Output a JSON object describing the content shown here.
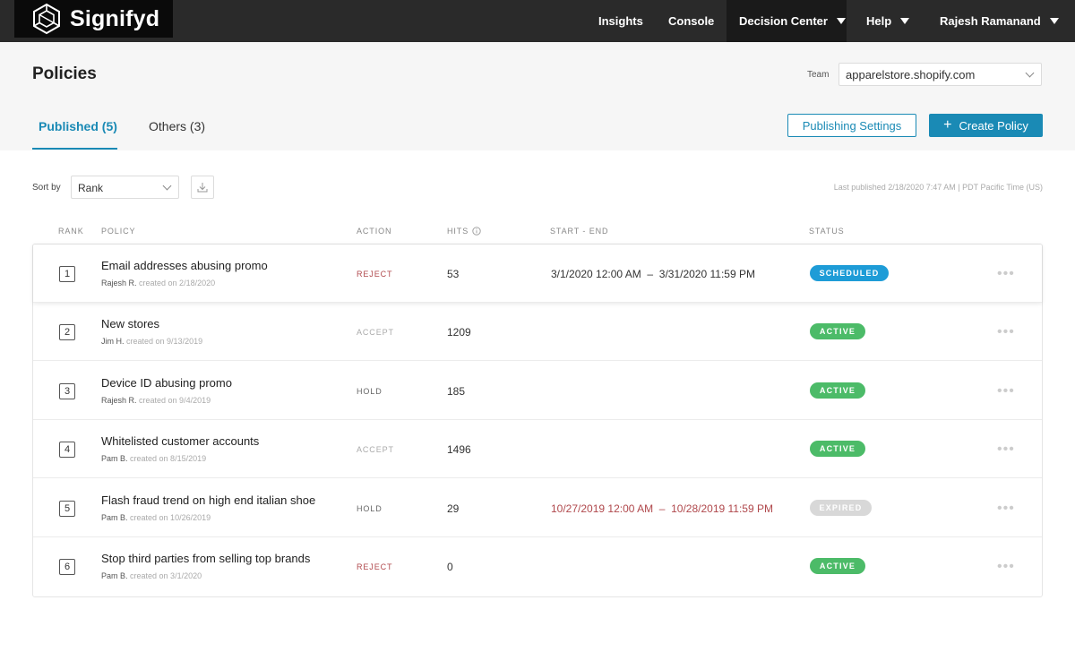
{
  "app": {
    "logo_text": "Signifyd"
  },
  "nav": {
    "insights": "Insights",
    "console": "Console",
    "decision_center": "Decision Center",
    "help": "Help",
    "user": "Rajesh Ramanand"
  },
  "page": {
    "title": "Policies",
    "team_label": "Team",
    "team_value": "apparelstore.shopify.com"
  },
  "tabs": {
    "published": "Published (5)",
    "others": "Others (3)"
  },
  "buttons": {
    "publishing_settings": "Publishing Settings",
    "create_policy": "Create Policy",
    "create_icon": "+"
  },
  "sort": {
    "label": "Sort by",
    "value": "Rank",
    "last_published": "Last published 2/18/2020 7:47 AM   |   PDT  Pacific Time (US)"
  },
  "columns": {
    "rank": "RANK",
    "policy": "POLICY",
    "action": "ACTION",
    "hits": "HITS",
    "start_end": "START - END",
    "status": "STATUS"
  },
  "colors": {
    "accent": "#1a8ab5",
    "reject": "#b0484c",
    "accept": "#aaaaaa",
    "hold": "#666666",
    "scheduled": "#1e9cd7",
    "active": "#4cbb68",
    "expired": "#d8d8d8",
    "expired_date": "#b0484c"
  },
  "rows": [
    {
      "rank": "1",
      "name": "Email addresses abusing promo",
      "who": "Rajesh R.",
      "created": "created on 2/18/2020",
      "action": "REJECT",
      "hits": "53",
      "start": "3/1/2020 12:00 AM",
      "end": "3/31/2020 11:59 PM",
      "status": "SCHEDULED",
      "dots": "•••"
    },
    {
      "rank": "2",
      "name": "New stores",
      "who": "Jim H.",
      "created": "created on 9/13/2019",
      "action": "ACCEPT",
      "hits": "1209",
      "start": "",
      "end": "",
      "status": "ACTIVE",
      "dots": "•••"
    },
    {
      "rank": "3",
      "name": "Device ID abusing promo",
      "who": "Rajesh R.",
      "created": "created on 9/4/2019",
      "action": "HOLD",
      "hits": "185",
      "start": "",
      "end": "",
      "status": "ACTIVE",
      "dots": "•••"
    },
    {
      "rank": "4",
      "name": "Whitelisted customer accounts",
      "who": "Pam B.",
      "created": "created on 8/15/2019",
      "action": "ACCEPT",
      "hits": "1496",
      "start": "",
      "end": "",
      "status": "ACTIVE",
      "dots": "•••"
    },
    {
      "rank": "5",
      "name": "Flash fraud trend on high end italian shoe",
      "who": "Pam B.",
      "created": "created on 10/26/2019",
      "action": "HOLD",
      "hits": "29",
      "start": "10/27/2019 12:00 AM",
      "end": "10/28/2019 11:59 PM",
      "status": "EXPIRED",
      "dots": "•••"
    },
    {
      "rank": "6",
      "name": "Stop third parties from selling top brands",
      "who": "Pam B.",
      "created": "created on 3/1/2020",
      "action": "REJECT",
      "hits": "0",
      "start": "",
      "end": "",
      "status": "ACTIVE",
      "dots": "•••"
    }
  ]
}
